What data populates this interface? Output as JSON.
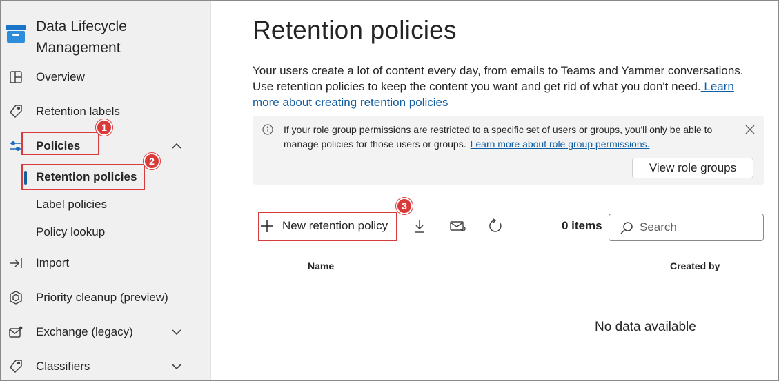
{
  "app": {
    "title_line1": "Data Lifecycle",
    "title_line2": "Management"
  },
  "sidebar": {
    "items": [
      {
        "label": "Overview",
        "icon": "overview-grid-icon"
      },
      {
        "label": "Retention labels",
        "icon": "tag-icon"
      },
      {
        "label": "Policies",
        "icon": "sliders-icon",
        "expanded": true
      },
      {
        "label": "Import",
        "icon": "import-arrow-icon"
      },
      {
        "label": "Priority cleanup (preview)",
        "icon": "cube-icon"
      },
      {
        "label": "Exchange (legacy)",
        "icon": "mail-settings-icon",
        "expandable": true
      },
      {
        "label": "Classifiers",
        "icon": "tag-icon",
        "expandable": true
      }
    ],
    "policies_sub": [
      {
        "label": "Retention policies",
        "active": true
      },
      {
        "label": "Label policies"
      },
      {
        "label": "Policy lookup"
      }
    ]
  },
  "callouts": [
    "1",
    "2",
    "3"
  ],
  "main": {
    "title": "Retention policies",
    "description": "Your users create a lot of content every day, from emails to Teams and Yammer conversations. Use retention policies to keep the content you want and get rid of what you don't need.",
    "description_link": " Learn more about creating retention policies",
    "info": {
      "text": "If your role group permissions are restricted to a specific set of users or groups, you'll only be able to manage policies for those users or groups.",
      "link": "Learn more about role group permissions.",
      "button": "View role groups"
    },
    "toolbar": {
      "new_policy": "New retention policy",
      "items_count": "0 items",
      "search_placeholder": "Search"
    },
    "table": {
      "columns": [
        "Name",
        "Created by"
      ],
      "empty_text": "No data available"
    }
  },
  "colors": {
    "accent": "#115ea3",
    "callout": "#d83b3b",
    "sidebar_bg": "#f0f0f0"
  }
}
